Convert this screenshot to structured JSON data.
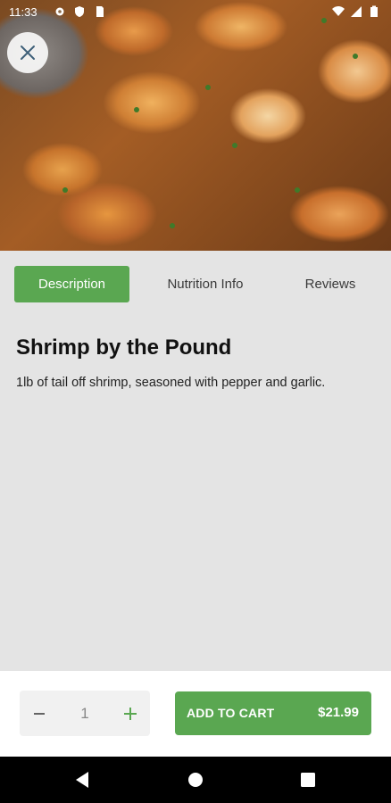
{
  "status_bar": {
    "time": "11:33",
    "left_icons": [
      "settings-icon",
      "shield-icon",
      "sim-card-icon"
    ],
    "right_icons": [
      "wifi-icon",
      "signal-icon",
      "battery-icon"
    ]
  },
  "hero": {
    "image": "shrimp-dish-image"
  },
  "tabs": [
    {
      "label": "Description",
      "active": true
    },
    {
      "label": "Nutrition Info",
      "active": false
    },
    {
      "label": "Reviews",
      "active": false
    }
  ],
  "product": {
    "title": "Shrimp by the Pound",
    "description": "1lb of tail off shrimp, seasoned with pepper and garlic."
  },
  "cart": {
    "quantity": "1",
    "add_label": "ADD TO CART",
    "price": "$21.99"
  },
  "colors": {
    "accent": "#5aa751",
    "background": "#e4e4e4"
  }
}
